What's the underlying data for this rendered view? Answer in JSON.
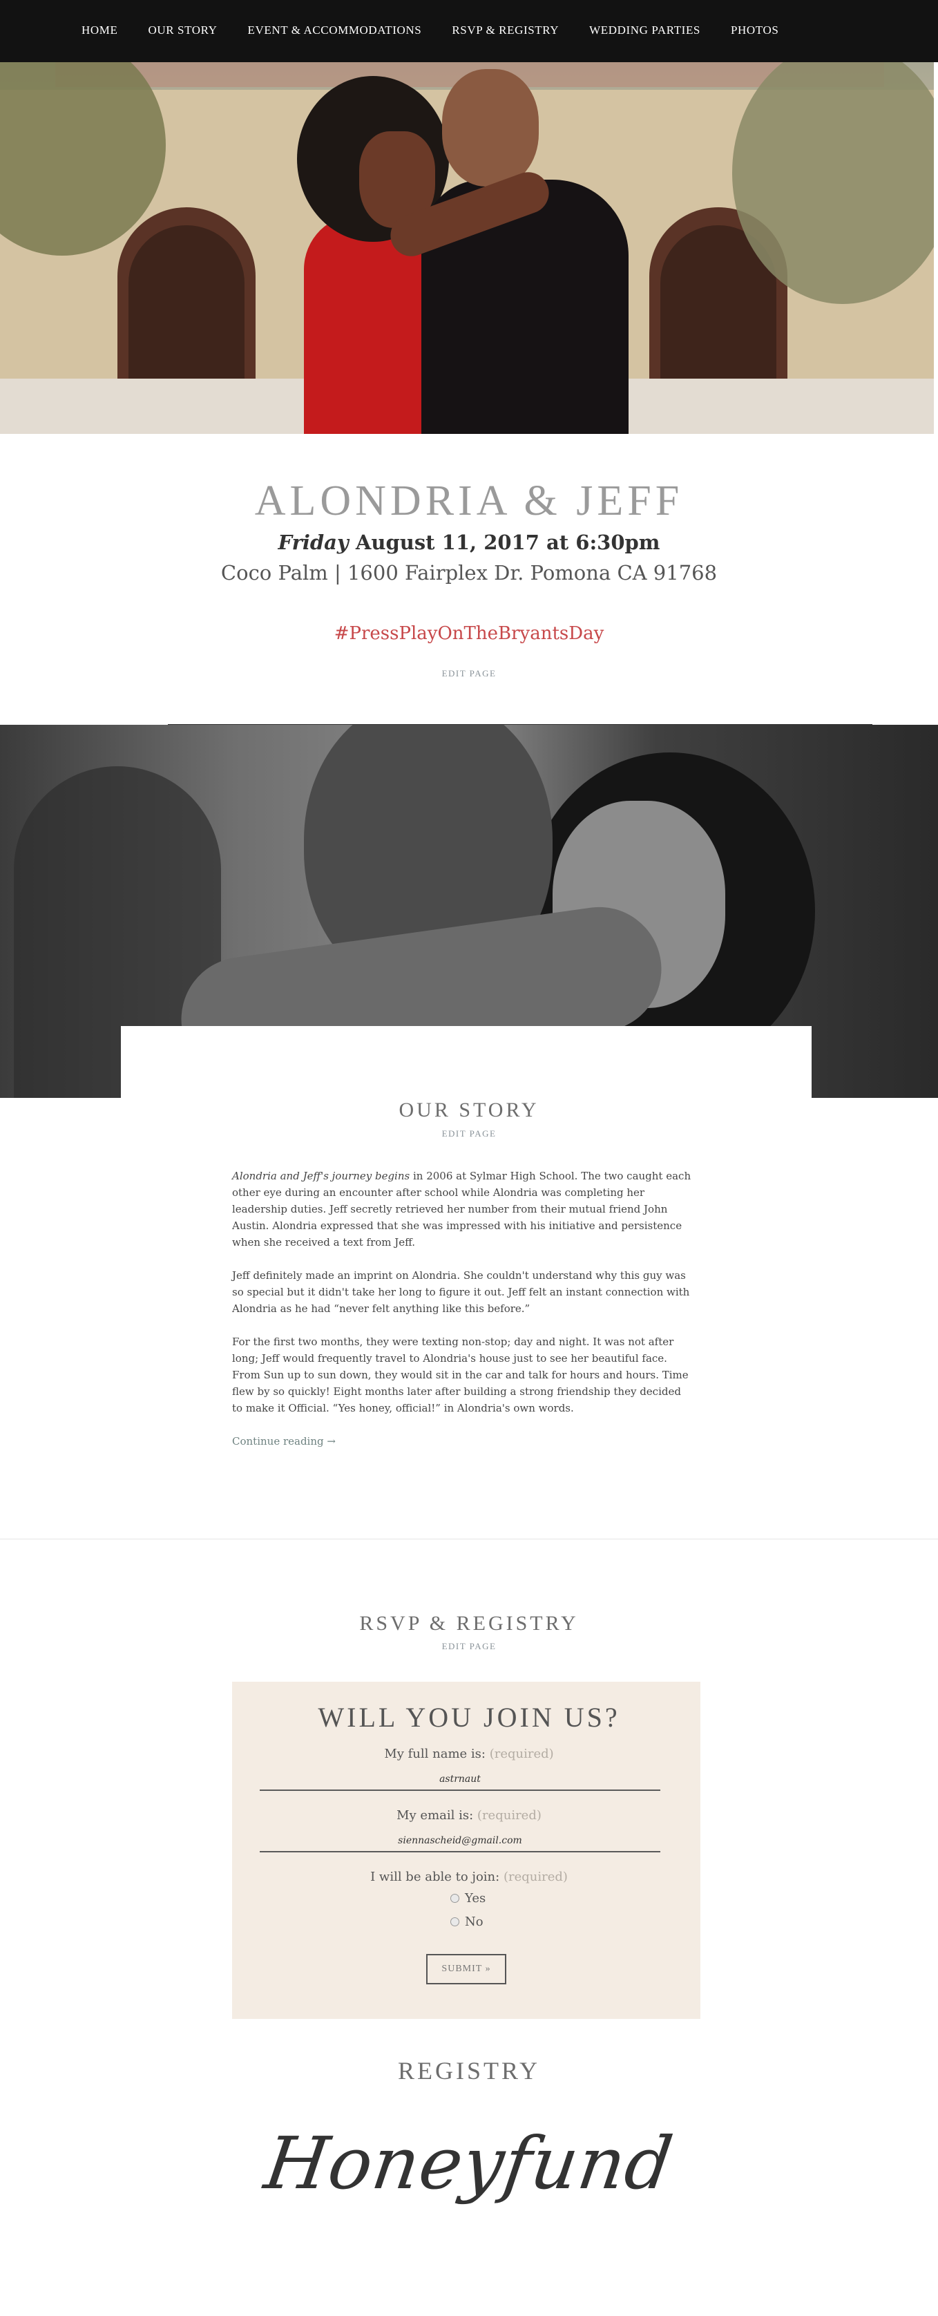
{
  "nav": {
    "items": [
      "HOME",
      "OUR STORY",
      "EVENT & ACCOMMODATIONS",
      "RSVP & REGISTRY",
      "WEDDING PARTIES",
      "PHOTOS"
    ]
  },
  "header": {
    "title": "ALONDRIA & JEFF",
    "date_day": "Friday",
    "date_rest": " August 11, 2017 at 6:30pm",
    "venue": "Coco Palm | 1600 Fairplex Dr. Pomona CA 91768",
    "hashtag": "#PressPlayOnTheBryantsDay",
    "edit_label": "EDIT PAGE"
  },
  "story": {
    "title": "OUR STORY",
    "edit_label": "EDIT PAGE",
    "p1_italic": "Alondria and Jeff's journey begins",
    "p1_rest": " in 2006 at Sylmar High School. The two caught each other eye during an encounter after school while Alondria was completing her leadership duties. Jeff secretly retrieved her number from their mutual friend John Austin. Alondria expressed that she was impressed with his initiative and persistence when she received a text from Jeff.",
    "p2": "Jeff definitely made an imprint on Alondria. She couldn't understand why this guy was so special but it didn't take her long to figure it out. Jeff felt an instant connection with Alondria as he had “never felt anything like this before.”",
    "p3": "For the first two months, they were texting non-stop; day and night. It was not after long; Jeff would frequently travel to Alondria's house just to see her beautiful face. From Sun up to sun down, they would sit in the car and talk for hours and hours. Time flew by so quickly! Eight months later after building a strong friendship they decided to make it Official. “Yes honey, official!” in Alondria's own words.",
    "continue": "Continue reading →"
  },
  "rsvp": {
    "section_title": "RSVP & REGISTRY",
    "edit_label": "EDIT PAGE",
    "form_title": "WILL YOU JOIN US?",
    "name_label": "My full name is:",
    "email_label": "My email is:",
    "join_label": "I will be able to join:",
    "required": "(required)",
    "name_value": "astrnaut",
    "email_value": "siennascheid@gmail.com",
    "option_yes": "Yes",
    "option_no": "No",
    "submit": "SUBMIT »"
  },
  "registry": {
    "title": "REGISTRY",
    "logo_text": "Honeyfund"
  },
  "colors": {
    "nav_bg": "#121212",
    "hashtag": "#c7484a",
    "form_bg": "#f4ece3",
    "link": "#6e8280"
  }
}
